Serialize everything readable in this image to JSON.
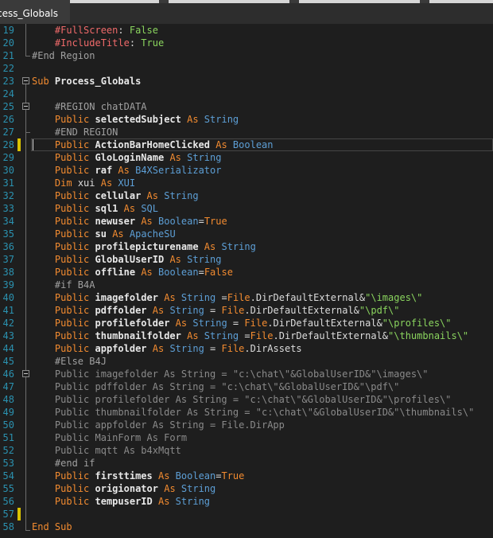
{
  "tab": {
    "title": "cess_Globals"
  },
  "lines": [
    {
      "n": "19",
      "parts": [
        [
          "    ",
          ""
        ],
        [
          "#FullScreen",
          "dir"
        ],
        [
          ": ",
          ""
        ],
        [
          "False",
          "val"
        ]
      ]
    },
    {
      "n": "20",
      "parts": [
        [
          "    ",
          ""
        ],
        [
          "#IncludeTitle",
          "dir"
        ],
        [
          ": ",
          ""
        ],
        [
          "True",
          "val"
        ]
      ]
    },
    {
      "n": "21",
      "parts": [
        [
          "#End Region",
          "pp"
        ]
      ]
    },
    {
      "n": "22",
      "parts": []
    },
    {
      "n": "23",
      "parts": [
        [
          "Sub",
          "kw"
        ],
        [
          " ",
          ""
        ],
        [
          "Process_Globals",
          "id"
        ]
      ]
    },
    {
      "n": "24",
      "parts": []
    },
    {
      "n": "25",
      "parts": [
        [
          "    ",
          ""
        ],
        [
          "#REGION chatDATA",
          "pp"
        ]
      ]
    },
    {
      "n": "26",
      "parts": [
        [
          "    ",
          ""
        ],
        [
          "Public",
          "kw"
        ],
        [
          " ",
          ""
        ],
        [
          "selectedSubject",
          "id"
        ],
        [
          " ",
          ""
        ],
        [
          "As",
          "kw"
        ],
        [
          " ",
          ""
        ],
        [
          "String",
          "ty"
        ]
      ]
    },
    {
      "n": "27",
      "parts": [
        [
          "    ",
          ""
        ],
        [
          "#END REGION",
          "pp"
        ]
      ]
    },
    {
      "n": "28",
      "parts": [
        [
          "    ",
          ""
        ],
        [
          "Public",
          "kw"
        ],
        [
          " ",
          ""
        ],
        [
          "ActionBarHomeClicked",
          "id"
        ],
        [
          " ",
          ""
        ],
        [
          "As",
          "kw"
        ],
        [
          " ",
          ""
        ],
        [
          "Boolean",
          "ty"
        ]
      ]
    },
    {
      "n": "29",
      "parts": [
        [
          "    ",
          ""
        ],
        [
          "Public",
          "kw"
        ],
        [
          " ",
          ""
        ],
        [
          "GloLoginName",
          "id"
        ],
        [
          " ",
          ""
        ],
        [
          "As",
          "kw"
        ],
        [
          " ",
          ""
        ],
        [
          "String",
          "ty"
        ]
      ]
    },
    {
      "n": "30",
      "parts": [
        [
          "    ",
          ""
        ],
        [
          "Public",
          "kw"
        ],
        [
          " ",
          ""
        ],
        [
          "raf",
          "id"
        ],
        [
          " ",
          ""
        ],
        [
          "As",
          "kw"
        ],
        [
          " ",
          ""
        ],
        [
          "B4XSerializator",
          "ty"
        ]
      ]
    },
    {
      "n": "31",
      "parts": [
        [
          "    ",
          ""
        ],
        [
          "Dim",
          "kw"
        ],
        [
          " xui ",
          "obj"
        ],
        [
          "As",
          "kw"
        ],
        [
          " ",
          ""
        ],
        [
          "XUI",
          "ty"
        ]
      ]
    },
    {
      "n": "32",
      "parts": [
        [
          "    ",
          ""
        ],
        [
          "Public",
          "kw"
        ],
        [
          " ",
          ""
        ],
        [
          "cellular",
          "id"
        ],
        [
          " ",
          ""
        ],
        [
          "As",
          "kw"
        ],
        [
          " ",
          ""
        ],
        [
          "String",
          "ty"
        ]
      ]
    },
    {
      "n": "33",
      "parts": [
        [
          "    ",
          ""
        ],
        [
          "Public",
          "kw"
        ],
        [
          " ",
          ""
        ],
        [
          "sql1",
          "id"
        ],
        [
          " ",
          ""
        ],
        [
          "As",
          "kw"
        ],
        [
          " ",
          ""
        ],
        [
          "SQL",
          "ty"
        ]
      ]
    },
    {
      "n": "34",
      "parts": [
        [
          "    ",
          ""
        ],
        [
          "Public",
          "kw"
        ],
        [
          " ",
          ""
        ],
        [
          "newuser",
          "id"
        ],
        [
          " ",
          ""
        ],
        [
          "As",
          "kw"
        ],
        [
          " ",
          ""
        ],
        [
          "Boolean",
          "ty"
        ],
        [
          "=",
          "obj"
        ],
        [
          "True",
          "kw"
        ]
      ]
    },
    {
      "n": "35",
      "parts": [
        [
          "    ",
          ""
        ],
        [
          "Public",
          "kw"
        ],
        [
          " ",
          ""
        ],
        [
          "su",
          "id"
        ],
        [
          " ",
          ""
        ],
        [
          "As",
          "kw"
        ],
        [
          " ",
          ""
        ],
        [
          "ApacheSU",
          "ty"
        ]
      ]
    },
    {
      "n": "36",
      "parts": [
        [
          "    ",
          ""
        ],
        [
          "Public",
          "kw"
        ],
        [
          " ",
          ""
        ],
        [
          "profilepicturename",
          "id"
        ],
        [
          " ",
          ""
        ],
        [
          "As",
          "kw"
        ],
        [
          " ",
          ""
        ],
        [
          "String",
          "ty"
        ]
      ]
    },
    {
      "n": "37",
      "parts": [
        [
          "    ",
          ""
        ],
        [
          "Public",
          "kw"
        ],
        [
          " ",
          ""
        ],
        [
          "GlobalUserID",
          "id"
        ],
        [
          " ",
          ""
        ],
        [
          "As",
          "kw"
        ],
        [
          " ",
          ""
        ],
        [
          "String",
          "ty"
        ]
      ]
    },
    {
      "n": "38",
      "parts": [
        [
          "    ",
          ""
        ],
        [
          "Public",
          "kw"
        ],
        [
          " ",
          ""
        ],
        [
          "offline",
          "id"
        ],
        [
          " ",
          ""
        ],
        [
          "As",
          "kw"
        ],
        [
          " ",
          ""
        ],
        [
          "Boolean",
          "ty"
        ],
        [
          "=",
          "obj"
        ],
        [
          "False",
          "kw"
        ]
      ]
    },
    {
      "n": "39",
      "parts": [
        [
          "    ",
          ""
        ],
        [
          "#if B4A",
          "pp"
        ]
      ]
    },
    {
      "n": "40",
      "parts": [
        [
          "    ",
          ""
        ],
        [
          "Public",
          "kw"
        ],
        [
          " ",
          ""
        ],
        [
          "imagefolder",
          "id"
        ],
        [
          " ",
          ""
        ],
        [
          "As",
          "kw"
        ],
        [
          " ",
          ""
        ],
        [
          "String",
          "ty"
        ],
        [
          " =",
          "obj"
        ],
        [
          "File",
          "kw"
        ],
        [
          ".DirDefaultExternal&",
          "obj"
        ],
        [
          "\"\\images\\\"",
          "str"
        ]
      ]
    },
    {
      "n": "41",
      "parts": [
        [
          "    ",
          ""
        ],
        [
          "Public",
          "kw"
        ],
        [
          " ",
          ""
        ],
        [
          "pdffolder",
          "id"
        ],
        [
          " ",
          ""
        ],
        [
          "As",
          "kw"
        ],
        [
          " ",
          ""
        ],
        [
          "String",
          "ty"
        ],
        [
          " = ",
          "obj"
        ],
        [
          "File",
          "kw"
        ],
        [
          ".DirDefaultExternal&",
          "obj"
        ],
        [
          "\"\\pdf\\\"",
          "str"
        ]
      ]
    },
    {
      "n": "42",
      "parts": [
        [
          "    ",
          ""
        ],
        [
          "Public",
          "kw"
        ],
        [
          " ",
          ""
        ],
        [
          "profilefolder",
          "id"
        ],
        [
          " ",
          ""
        ],
        [
          "As",
          "kw"
        ],
        [
          " ",
          ""
        ],
        [
          "String",
          "ty"
        ],
        [
          " = ",
          "obj"
        ],
        [
          "File",
          "kw"
        ],
        [
          ".DirDefaultExternal&",
          "obj"
        ],
        [
          "\"\\profiles\\\"",
          "str"
        ]
      ]
    },
    {
      "n": "43",
      "parts": [
        [
          "    ",
          ""
        ],
        [
          "Public",
          "kw"
        ],
        [
          " ",
          ""
        ],
        [
          "thumbnailfolder",
          "id"
        ],
        [
          " ",
          ""
        ],
        [
          "As",
          "kw"
        ],
        [
          " ",
          ""
        ],
        [
          "String",
          "ty"
        ],
        [
          " =",
          "obj"
        ],
        [
          "File",
          "kw"
        ],
        [
          ".DirDefaultExternal&",
          "obj"
        ],
        [
          "\"\\thumbnails\\\"",
          "str"
        ]
      ]
    },
    {
      "n": "44",
      "parts": [
        [
          "    ",
          ""
        ],
        [
          "Public",
          "kw"
        ],
        [
          " ",
          ""
        ],
        [
          "appfolder",
          "id"
        ],
        [
          " ",
          ""
        ],
        [
          "As",
          "kw"
        ],
        [
          " ",
          ""
        ],
        [
          "String",
          "ty"
        ],
        [
          " = ",
          "obj"
        ],
        [
          "File",
          "kw"
        ],
        [
          ".DirAssets",
          "obj"
        ]
      ]
    },
    {
      "n": "45",
      "parts": [
        [
          "    ",
          ""
        ],
        [
          "#Else B4J",
          "pp"
        ]
      ]
    },
    {
      "n": "46",
      "parts": [
        [
          "    Public imagefolder As String = \"c:\\chat\\\"&GlobalUserID&\"\\images\\\"",
          "dim"
        ]
      ]
    },
    {
      "n": "47",
      "parts": [
        [
          "    Public pdffolder As String = \"c:\\chat\\\"&GlobalUserID&\"\\pdf\\\"",
          "dim"
        ]
      ]
    },
    {
      "n": "48",
      "parts": [
        [
          "    Public profilefolder As String = \"c:\\chat\\\"&GlobalUserID&\"\\profiles\\\"",
          "dim"
        ]
      ]
    },
    {
      "n": "49",
      "parts": [
        [
          "    Public thumbnailfolder As String = \"c:\\chat\\\"&GlobalUserID&\"\\thumbnails\\\"",
          "dim"
        ]
      ]
    },
    {
      "n": "50",
      "parts": [
        [
          "    Public appfolder As String = File.DirApp",
          "dim"
        ]
      ]
    },
    {
      "n": "51",
      "parts": [
        [
          "    Public MainForm As Form",
          "dim"
        ]
      ]
    },
    {
      "n": "52",
      "parts": [
        [
          "    Public mqtt As b4xMqtt",
          "dim"
        ]
      ]
    },
    {
      "n": "53",
      "parts": [
        [
          "    ",
          ""
        ],
        [
          "#end if",
          "pp"
        ]
      ]
    },
    {
      "n": "54",
      "parts": [
        [
          "    ",
          ""
        ],
        [
          "Public",
          "kw"
        ],
        [
          " ",
          ""
        ],
        [
          "firsttimes",
          "id"
        ],
        [
          " ",
          ""
        ],
        [
          "As",
          "kw"
        ],
        [
          " ",
          ""
        ],
        [
          "Boolean",
          "ty"
        ],
        [
          "=",
          "obj"
        ],
        [
          "True",
          "kw"
        ]
      ]
    },
    {
      "n": "55",
      "parts": [
        [
          "    ",
          ""
        ],
        [
          "Public",
          "kw"
        ],
        [
          " ",
          ""
        ],
        [
          "origionator",
          "id"
        ],
        [
          " ",
          ""
        ],
        [
          "As",
          "kw"
        ],
        [
          " ",
          ""
        ],
        [
          "String",
          "ty"
        ]
      ]
    },
    {
      "n": "56",
      "parts": [
        [
          "    ",
          ""
        ],
        [
          "Public",
          "kw"
        ],
        [
          " ",
          ""
        ],
        [
          "tempuserID",
          "id"
        ],
        [
          " ",
          ""
        ],
        [
          "As",
          "kw"
        ],
        [
          " ",
          ""
        ],
        [
          "String",
          "ty"
        ]
      ]
    },
    {
      "n": "57",
      "parts": []
    },
    {
      "n": "58",
      "parts": [
        [
          "End",
          "kw"
        ],
        [
          " ",
          ""
        ],
        [
          "Sub",
          "kw"
        ]
      ]
    }
  ],
  "colors": {
    "background": "#1e1e1e",
    "line_number": "#2b91af",
    "keyword": "#f28b30",
    "type": "#5d9fd6",
    "string": "#8ad45e",
    "change_marker": "#d9c200"
  }
}
